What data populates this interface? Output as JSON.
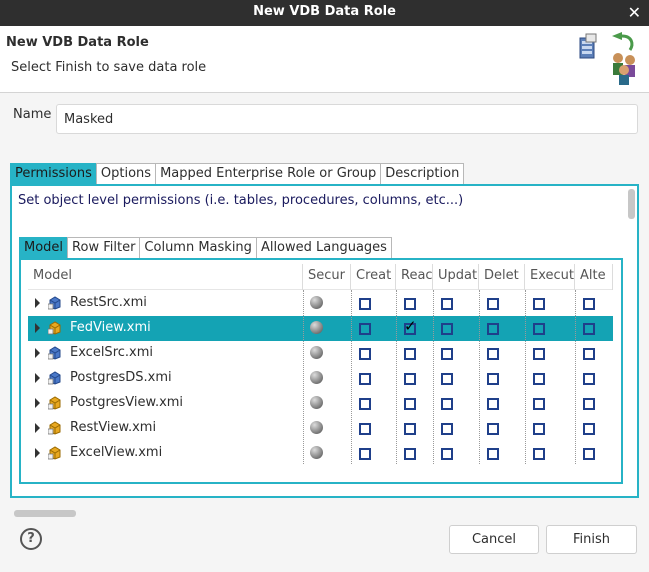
{
  "window": {
    "title": "New VDB Data Role"
  },
  "header": {
    "title": "New VDB Data Role",
    "subtitle": "Select Finish to save data role",
    "icon": "data-role-wizard-icon"
  },
  "form": {
    "name_label": "Name",
    "name_value": "Masked"
  },
  "outer_tabs": [
    {
      "label": "Permissions",
      "active": true
    },
    {
      "label": "Options",
      "active": false
    },
    {
      "label": "Mapped Enterprise Role or Group",
      "active": false
    },
    {
      "label": "Description",
      "active": false
    }
  ],
  "permissions": {
    "instruction": "Set object level permissions (i.e. tables, procedures, columns, etc...)",
    "inner_tabs": [
      {
        "label": "Model",
        "active": true
      },
      {
        "label": "Row Filter",
        "active": false
      },
      {
        "label": "Column Masking",
        "active": false
      },
      {
        "label": "Allowed Languages",
        "active": false
      }
    ],
    "columns": [
      "Model",
      "Secur",
      "Creat",
      "Reac",
      "Updat",
      "Delet",
      "Execut",
      "Alte"
    ],
    "rows": [
      {
        "name": "RestSrc.xmi",
        "type": "source",
        "selected": false,
        "checks": [
          false,
          false,
          false,
          false,
          false,
          false
        ]
      },
      {
        "name": "FedView.xmi",
        "type": "view",
        "selected": true,
        "checks": [
          false,
          true,
          false,
          false,
          false,
          false
        ]
      },
      {
        "name": "ExcelSrc.xmi",
        "type": "source",
        "selected": false,
        "checks": [
          false,
          false,
          false,
          false,
          false,
          false
        ]
      },
      {
        "name": "PostgresDS.xmi",
        "type": "source",
        "selected": false,
        "checks": [
          false,
          false,
          false,
          false,
          false,
          false
        ]
      },
      {
        "name": "PostgresView.xmi",
        "type": "view",
        "selected": false,
        "checks": [
          false,
          false,
          false,
          false,
          false,
          false
        ]
      },
      {
        "name": "RestView.xmi",
        "type": "view",
        "selected": false,
        "checks": [
          false,
          false,
          false,
          false,
          false,
          false
        ]
      },
      {
        "name": "ExcelView.xmi",
        "type": "view",
        "selected": false,
        "checks": [
          false,
          false,
          false,
          false,
          false,
          false
        ]
      }
    ]
  },
  "buttons": {
    "help": "?",
    "cancel": "Cancel",
    "finish": "Finish"
  },
  "colors": {
    "accent": "#27b3c6",
    "selection": "#14a3b4",
    "titlebar": "#2f2f2f",
    "checkbox": "#1f3f8a"
  }
}
